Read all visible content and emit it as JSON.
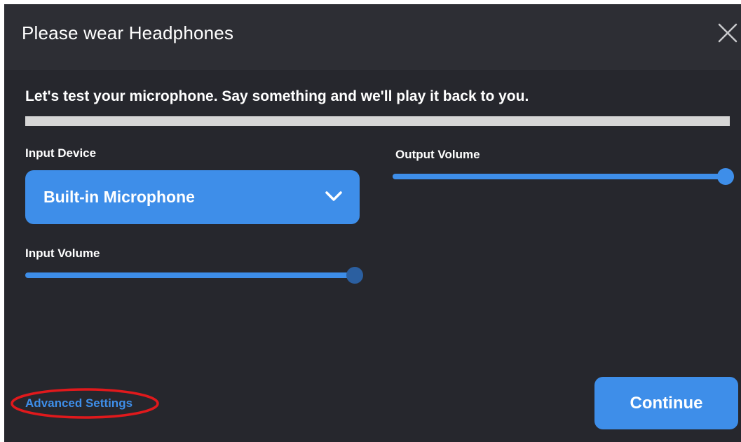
{
  "dialog": {
    "title": "Please wear Headphones",
    "close_icon": "close-icon"
  },
  "mic_test": {
    "instructions": "Let's test your microphone. Say something and we'll play it back to you.",
    "level_percent": 0
  },
  "input_device": {
    "label": "Input Device",
    "selected": "Built-in Microphone",
    "dropdown_icon": "chevron-down-icon"
  },
  "output_volume": {
    "label": "Output Volume",
    "value_percent": 100
  },
  "input_volume": {
    "label": "Input Volume",
    "value_percent": 100
  },
  "footer": {
    "advanced_settings_label": "Advanced Settings",
    "continue_label": "Continue"
  },
  "colors": {
    "accent": "#3e8ee9",
    "background": "#26272d",
    "titlebar": "#2d2e34",
    "annotation": "#e0191c"
  }
}
